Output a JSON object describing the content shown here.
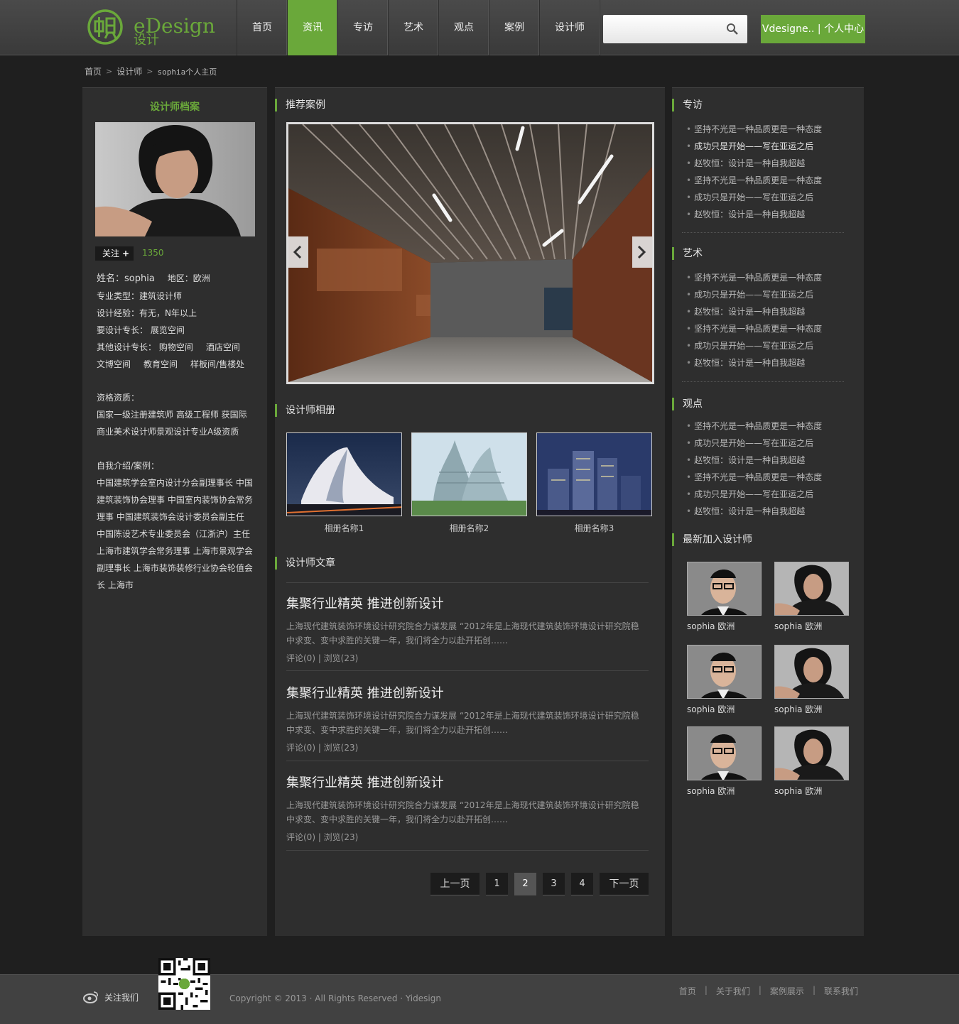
{
  "header": {
    "logo_en": "eDesign",
    "logo_cn": "设计",
    "nav": [
      "首页",
      "资讯",
      "专访",
      "艺术",
      "观点",
      "案例",
      "设计师"
    ],
    "active_nav": "资讯",
    "search_placeholder": "",
    "user_center": "Vdesigne.. | 个人中心"
  },
  "breadcrumb": [
    "首页",
    "设计师",
    "sophia个人主页"
  ],
  "profile": {
    "title": "设计师档案",
    "follow_label": "关注",
    "follow_count": "1350",
    "name": "姓名：sophia",
    "region": "地区：欧洲",
    "major_type": "专业类型：建筑设计师",
    "experience": "设计经验：有无，N年以上",
    "main_specialty": "要设计专长：  展览空间",
    "other_specialty_label": "其他设计专长：",
    "other_specialty_1": "购物空间",
    "other_specialty_2": "酒店空间",
    "other_specialty_3": "文博空间",
    "other_specialty_4": "教育空间",
    "other_specialty_5": "样板间/售楼处",
    "qual_label": "资格资质：",
    "qual_line1": "国家一级注册建筑师 高级工程师 获国际",
    "qual_line2": "商业美术设计师景观设计专业A级资质",
    "intro_label": "自我介绍/案例：",
    "intro_lines": [
      "中国建筑学会室内设计分会副理事长 中国",
      "建筑装饰协会理事 中国室内装饰协会常务",
      "理事 中国建筑装饰会设计委员会副主任",
      "中国陈设艺术专业委员会（江浙沪）主任",
      "上海市建筑学会常务理事 上海市景观学会",
      "副理事长 上海市装饰装修行业协会轮值会",
      "长 上海市"
    ]
  },
  "middle": {
    "featured_title": "推荐案例",
    "album_title": "设计师相册",
    "albums": [
      "相册名称1",
      "相册名称2",
      "相册名称3"
    ],
    "articles_title": "设计师文章",
    "articles": [
      {
        "title": "集聚行业精英 推进创新设计",
        "body1": "上海现代建筑装饰环境设计研究院合力谋发展  “2012年是上海现代建筑装饰环境设计研究院稳",
        "body2": "中求变、变中求胜的关键一年，我们将全力以赴开拓创……",
        "meta": "评论(0) | 浏览(23)"
      },
      {
        "title": "集聚行业精英 推进创新设计",
        "body1": "上海现代建筑装饰环境设计研究院合力谋发展  “2012年是上海现代建筑装饰环境设计研究院稳",
        "body2": "中求变、变中求胜的关键一年，我们将全力以赴开拓创……",
        "meta": "评论(0) | 浏览(23)"
      },
      {
        "title": "集聚行业精英 推进创新设计",
        "body1": "上海现代建筑装饰环境设计研究院合力谋发展  “2012年是上海现代建筑装饰环境设计研究院稳",
        "body2": "中求变、变中求胜的关键一年，我们将全力以赴开拓创……",
        "meta": "评论(0) | 浏览(23)"
      }
    ],
    "pager": {
      "prev": "上一页",
      "pages": [
        "1",
        "2",
        "3",
        "4"
      ],
      "current": "2",
      "next": "下一页"
    }
  },
  "right": {
    "sections": [
      {
        "title": "专访",
        "items": [
          "坚持不光是一种品质更是一种态度",
          "成功只是开始——写在亚运之后",
          "赵牧恒：设计是一种自我超越",
          "坚持不光是一种品质更是一种态度",
          "成功只是开始——写在亚运之后",
          "赵牧恒：设计是一种自我超越"
        ]
      },
      {
        "title": "艺术",
        "items": [
          "坚持不光是一种品质更是一种态度",
          "成功只是开始——写在亚运之后",
          "赵牧恒：设计是一种自我超越",
          "坚持不光是一种品质更是一种态度",
          "成功只是开始——写在亚运之后",
          "赵牧恒：设计是一种自我超越"
        ]
      },
      {
        "title": "观点",
        "items": [
          "坚持不光是一种品质更是一种态度",
          "成功只是开始——写在亚运之后",
          "赵牧恒：设计是一种自我超越",
          "坚持不光是一种品质更是一种态度",
          "成功只是开始——写在亚运之后",
          "赵牧恒：设计是一种自我超越"
        ]
      }
    ],
    "new_designers_title": "最新加入设计师",
    "designer_caption": "sophia  欧洲"
  },
  "footer": {
    "weibo": "关注我们",
    "copyright": "Copyright © 2013 · All Rights Reserved · Yidesign",
    "links": [
      "首页",
      "关于我们",
      "案例展示",
      "联系我们"
    ]
  },
  "colors": {
    "accent": "#6aa83a",
    "background": "#1f1f1f",
    "panel": "#2e2e2e"
  }
}
